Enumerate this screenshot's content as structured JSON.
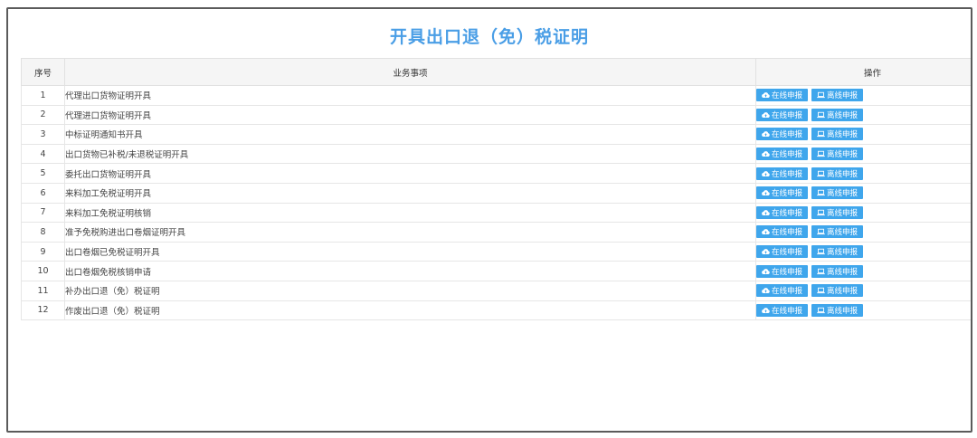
{
  "page": {
    "title": "开具出口退（免）税证明"
  },
  "table": {
    "headers": {
      "seq": "序号",
      "item": "业务事项",
      "ops": "操作"
    },
    "buttons": {
      "online_label": "在线申报",
      "offline_label": "离线申报",
      "online_icon": "cloud-upload-icon",
      "offline_icon": "laptop-icon"
    },
    "rows": [
      {
        "seq": "1",
        "item": "代理出口货物证明开具"
      },
      {
        "seq": "2",
        "item": "代理进口货物证明开具"
      },
      {
        "seq": "3",
        "item": "中标证明通知书开具"
      },
      {
        "seq": "4",
        "item": "出口货物已补税/未退税证明开具"
      },
      {
        "seq": "5",
        "item": "委托出口货物证明开具"
      },
      {
        "seq": "6",
        "item": "来料加工免税证明开具"
      },
      {
        "seq": "7",
        "item": "来料加工免税证明核销"
      },
      {
        "seq": "8",
        "item": "准予免税购进出口卷烟证明开具"
      },
      {
        "seq": "9",
        "item": "出口卷烟已免税证明开具"
      },
      {
        "seq": "10",
        "item": "出口卷烟免税核销申请"
      },
      {
        "seq": "11",
        "item": "补办出口退（免）税证明"
      },
      {
        "seq": "12",
        "item": "作废出口退（免）税证明"
      }
    ]
  },
  "colors": {
    "title": "#4a9ee6",
    "button": "#3fa6ec",
    "header_bg": "#f5f5f5",
    "frame_border": "#5b5b5b"
  }
}
